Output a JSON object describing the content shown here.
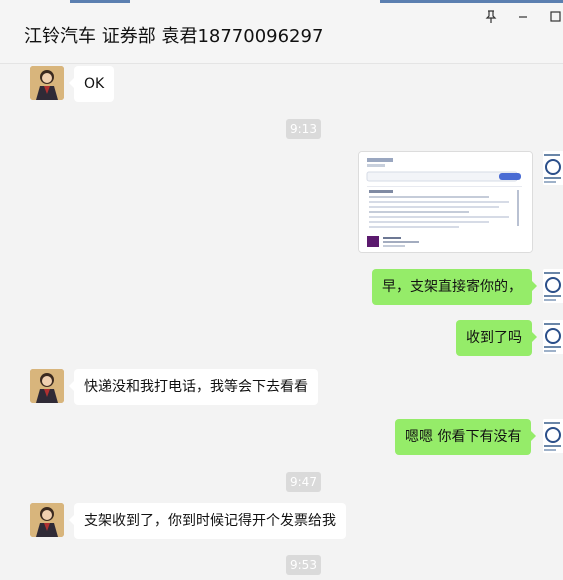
{
  "window": {
    "title": "江铃汽车 证券部 袁君18770096297",
    "buttons": [
      "pin-icon",
      "minimize-icon",
      "maximize-icon"
    ]
  },
  "colors": {
    "outgoing_bubble": "#95ec69",
    "incoming_bubble": "#ffffff",
    "background": "#f3f3f3",
    "timestamp_chip": "#dadada"
  },
  "messages": [
    {
      "type": "text",
      "direction": "incoming",
      "text": "OK"
    },
    {
      "type": "timestamp",
      "text": "9:13"
    },
    {
      "type": "image",
      "direction": "outgoing",
      "image": "screenshot-thumbnail"
    },
    {
      "type": "text",
      "direction": "outgoing",
      "text": "早，支架直接寄你的，"
    },
    {
      "type": "text",
      "direction": "outgoing",
      "text": "收到了吗"
    },
    {
      "type": "text",
      "direction": "incoming",
      "text": "快递没和我打电话，我等会下去看看"
    },
    {
      "type": "text",
      "direction": "outgoing",
      "text": "嗯嗯 你看下有没有"
    },
    {
      "type": "timestamp",
      "text": "9:47"
    },
    {
      "type": "text",
      "direction": "incoming",
      "text": "支架收到了，你到时候记得开个发票给我"
    },
    {
      "type": "timestamp",
      "text": "9:53"
    }
  ]
}
